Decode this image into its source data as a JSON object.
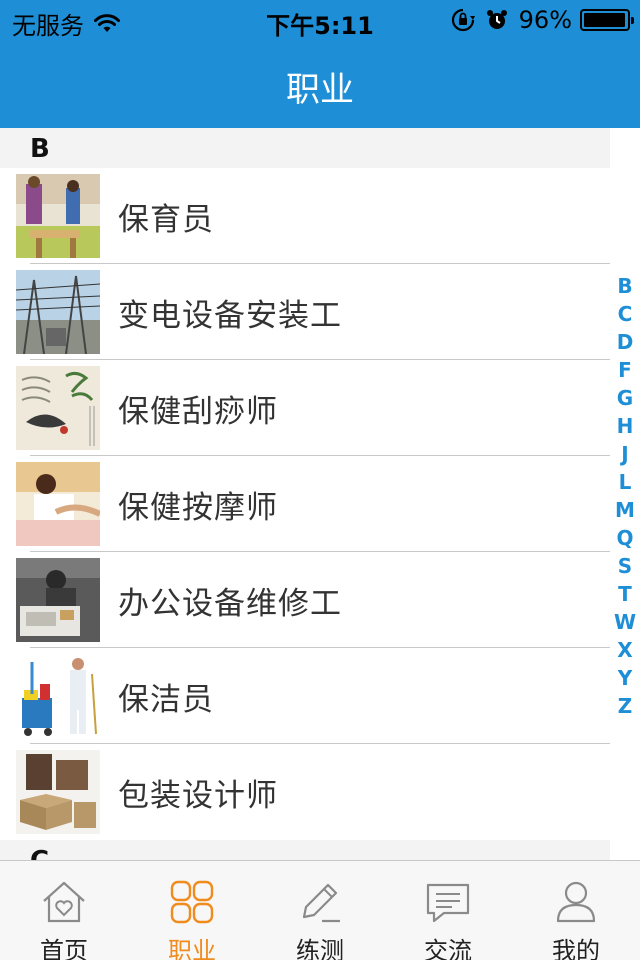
{
  "status_bar": {
    "carrier": "无服务",
    "time": "下午5:11",
    "battery": "96%",
    "battery_level": 0.96
  },
  "nav": {
    "title": "职业"
  },
  "sections": [
    {
      "letter": "B",
      "items": [
        {
          "label": "保育员",
          "thumb": "photo-nursery"
        },
        {
          "label": "变电设备安装工",
          "thumb": "photo-substation"
        },
        {
          "label": "保健刮痧师",
          "thumb": "photo-guasha"
        },
        {
          "label": "保健按摩师",
          "thumb": "photo-massage"
        },
        {
          "label": "办公设备维修工",
          "thumb": "photo-office-repair"
        },
        {
          "label": "保洁员",
          "thumb": "photo-cleaner"
        },
        {
          "label": "包装设计师",
          "thumb": "photo-packaging"
        }
      ]
    },
    {
      "letter": "C",
      "items": []
    }
  ],
  "index_letters": [
    "B",
    "C",
    "D",
    "F",
    "G",
    "H",
    "J",
    "L",
    "M",
    "Q",
    "S",
    "T",
    "W",
    "X",
    "Y",
    "Z"
  ],
  "tabs": [
    {
      "label": "首页",
      "icon": "house-heart-icon",
      "active": false
    },
    {
      "label": "职业",
      "icon": "grid-icon",
      "active": true
    },
    {
      "label": "练测",
      "icon": "pencil-icon",
      "active": false
    },
    {
      "label": "交流",
      "icon": "chat-icon",
      "active": false
    },
    {
      "label": "我的",
      "icon": "person-icon",
      "active": false
    }
  ],
  "colors": {
    "header": "#1e8fd6",
    "index_text": "#1e8fd6",
    "tab_active": "#f08c1e",
    "tab_inactive": "#8a8a8a"
  }
}
